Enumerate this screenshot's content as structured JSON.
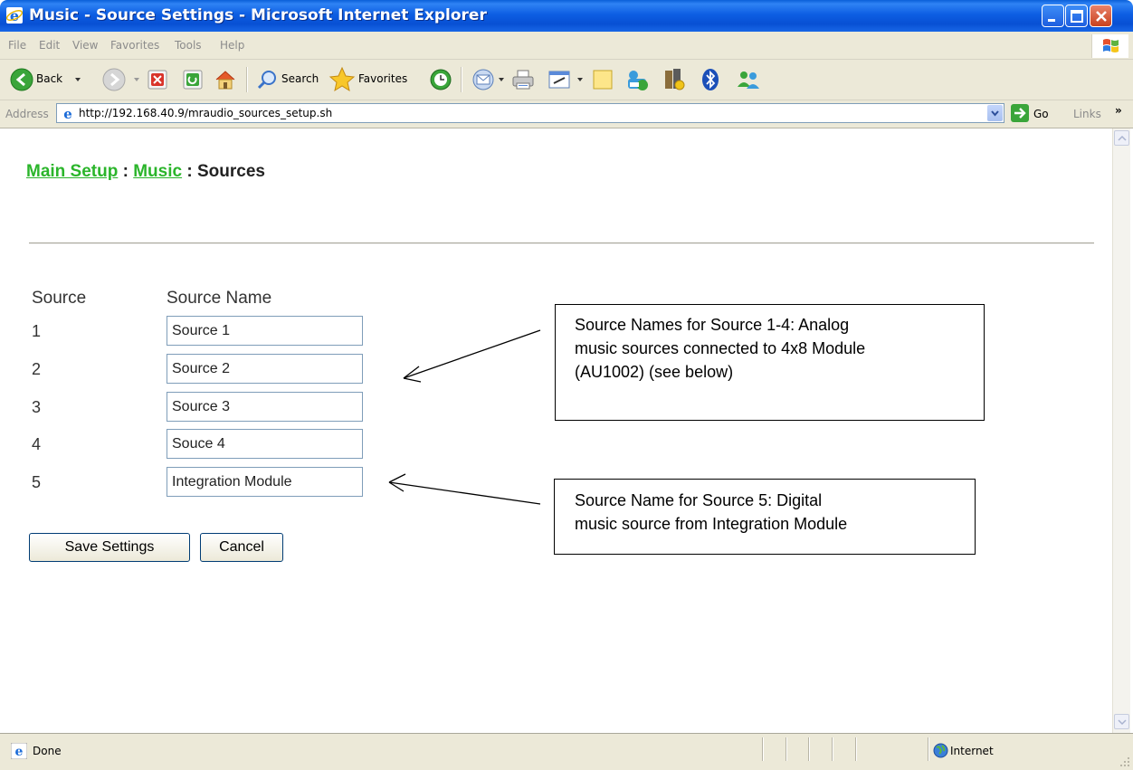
{
  "window": {
    "title": "Music - Source Settings - Microsoft Internet Explorer"
  },
  "menu": [
    "File",
    "Edit",
    "View",
    "Favorites",
    "Tools",
    "Help"
  ],
  "toolbar": {
    "back_label": "Back",
    "search_label": "Search",
    "favorites_label": "Favorites"
  },
  "address": {
    "label": "Address",
    "url": "http://192.168.40.9/mraudio_sources_setup.sh",
    "go_label": "Go",
    "links_label": "Links",
    "links_chevron": "»"
  },
  "breadcrumb": {
    "main_setup": "Main Setup",
    "sep1": " : ",
    "music": "Music",
    "sep2": " : ",
    "current": "Sources"
  },
  "table": {
    "col_source": "Source",
    "col_name": "Source Name",
    "rows": [
      {
        "num": "1",
        "name": "Source 1"
      },
      {
        "num": "2",
        "name": "Source 2"
      },
      {
        "num": "3",
        "name": "Source 3"
      },
      {
        "num": "4",
        "name": "Souce 4"
      },
      {
        "num": "5",
        "name": "Integration Module"
      }
    ]
  },
  "buttons": {
    "save": "Save Settings",
    "cancel": "Cancel"
  },
  "callouts": {
    "analog": {
      "line1": "Source Names for Source 1-4: Analog",
      "line2": "music sources connected to 4x8 Module",
      "line3": "(AU1002) (see below)"
    },
    "digital": {
      "line1": "Source Name for Source 5: Digital",
      "line2": "music source from Integration Module"
    }
  },
  "status": {
    "left": "Done",
    "zone": "Internet"
  },
  "colors": {
    "title_bar": "#0a5fd9",
    "link_green": "#2bb52b",
    "chrome": "#ece9d8"
  }
}
